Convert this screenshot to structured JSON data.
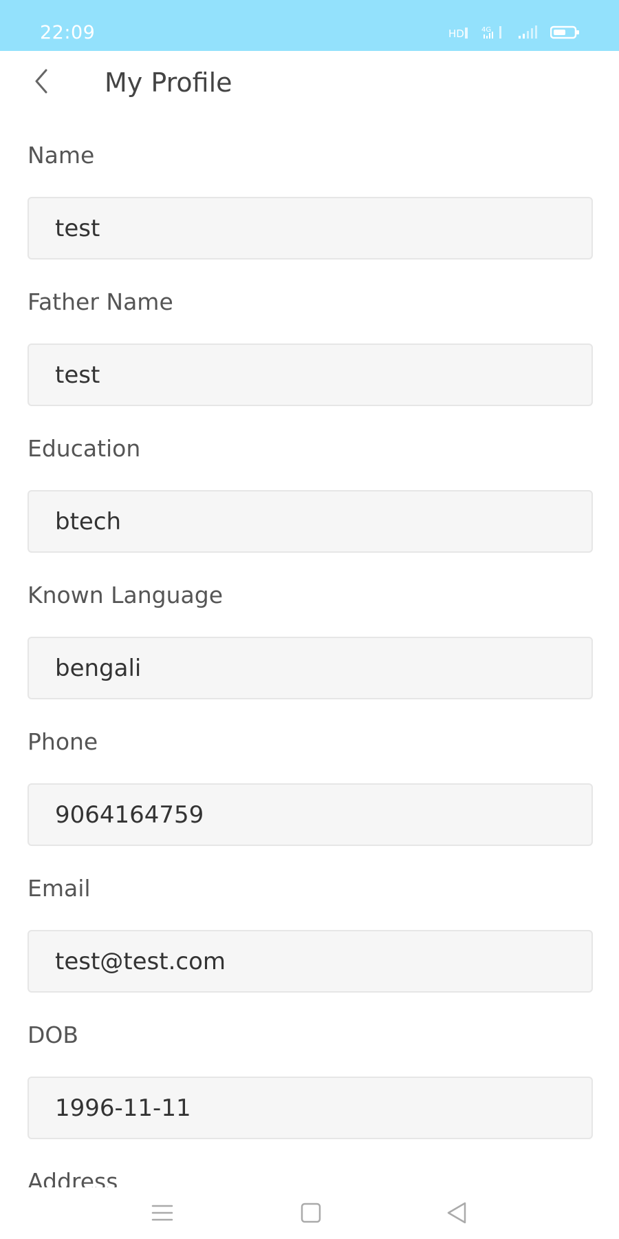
{
  "status_bar": {
    "time": "22:09",
    "background": "#93e1fc",
    "icons": [
      "hd-volte-icon",
      "network-4g-icon",
      "signal-icon",
      "battery-icon"
    ]
  },
  "header": {
    "title": "My Profile",
    "back_icon": "chevron-left-icon"
  },
  "form": {
    "fields": [
      {
        "label": "Name",
        "value": "test"
      },
      {
        "label": "Father Name",
        "value": "test"
      },
      {
        "label": "Education",
        "value": "btech"
      },
      {
        "label": "Known Language",
        "value": "bengali"
      },
      {
        "label": "Phone",
        "value": "9064164759"
      },
      {
        "label": "Email",
        "value": "test@test.com"
      },
      {
        "label": "DOB",
        "value": "1996-11-11"
      },
      {
        "label": "Address",
        "value": ""
      }
    ]
  },
  "nav_bar": {
    "icons": [
      "menu-icon",
      "home-square-icon",
      "back-triangle-icon"
    ]
  }
}
